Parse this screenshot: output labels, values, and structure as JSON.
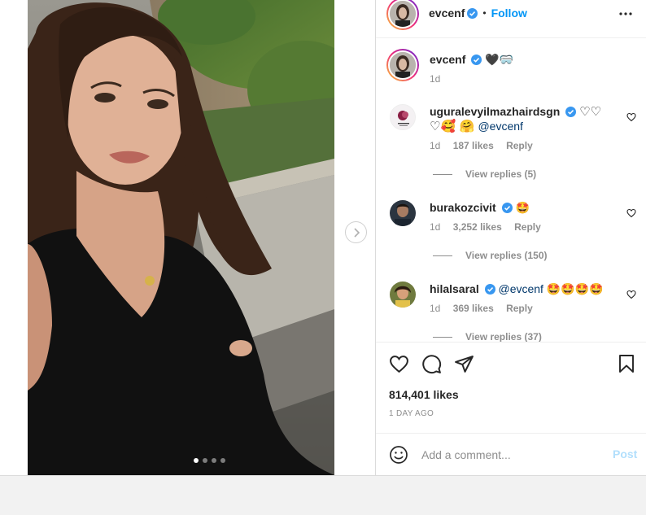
{
  "post": {
    "author": "evcenf",
    "follow_label": "Follow",
    "separator": "•",
    "caption_emojis": "🖤🥽",
    "caption_time": "1d"
  },
  "comments": [
    {
      "username": "uguralevyilmazhairdsgn",
      "text_line1_suffix": "♡♡",
      "text_line2_emojis": "♡🥰 🤗",
      "mention": "@evcenf",
      "time": "1d",
      "likes": "187 likes",
      "reply": "Reply",
      "view_replies": "View replies (5)"
    },
    {
      "username": "burakozcivit",
      "text": "🤩",
      "time": "1d",
      "likes": "3,252 likes",
      "reply": "Reply",
      "view_replies": "View replies (150)"
    },
    {
      "username": "hilalsaral",
      "mention": "@evcenf",
      "text": "🤩🤩🤩🤩",
      "time": "1d",
      "likes": "369 likes",
      "reply": "Reply",
      "view_replies": "View replies (37)"
    }
  ],
  "engagement": {
    "likes": "814,401 likes",
    "time_ago": "1 DAY AGO"
  },
  "composer": {
    "placeholder": "Add a comment...",
    "post_label": "Post"
  },
  "carousel": {
    "slide_count": 4,
    "active_index": 0
  },
  "icons": {
    "more": "more-horizontal-icon",
    "verified": "verified-badge-icon",
    "like": "heart-icon",
    "comment": "comment-icon",
    "share": "send-icon",
    "save": "bookmark-icon",
    "emoji": "emoji-icon",
    "next": "chevron-right-icon"
  },
  "colors": {
    "accent": "#0095f6",
    "verified": "#3897f0",
    "post_disabled": "#b2dffc",
    "muted_text": "#8e8e8e"
  }
}
